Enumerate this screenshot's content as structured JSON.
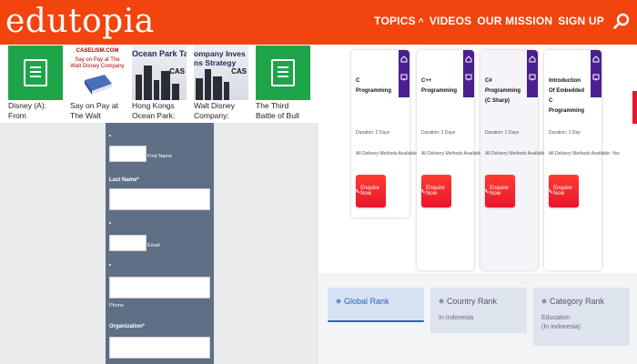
{
  "header": {
    "logo": "edutopia",
    "nav": [
      {
        "label": "TOPICS",
        "has_caret": true
      },
      {
        "label": "VIDEOS"
      },
      {
        "label": "OUR MISSION"
      },
      {
        "label": "SIGN UP"
      }
    ],
    "caret": "^",
    "search_icon": "search-icon",
    "color": "#f2440f"
  },
  "thumbnails": [
    {
      "kind": "notebook",
      "caption": "Disney (A): From"
    },
    {
      "kind": "book",
      "caption": "Say on Pay at The Walt",
      "top_text": "CASELISM.COM",
      "title_text": "Say on Pay at The Walt Disney Company"
    },
    {
      "kind": "city",
      "caption": "Hong Kongs Ocean Park:",
      "title_text": "Ocean Park Tal",
      "badge_text": "CAS"
    },
    {
      "kind": "city",
      "caption": "Walt Disney Company:",
      "title_text": "ompany Inves ns Strategy",
      "badge_text": "CAS"
    },
    {
      "kind": "notebook",
      "caption": "The Third Battle of Bull Run: The"
    }
  ],
  "form": {
    "first_name_label": "First Name",
    "last_name_label": "Last Name*",
    "email_label": "Email",
    "phone_label": "Phone",
    "organization_label": "Organization*",
    "bg_color": "#5f6f84"
  },
  "courses": [
    {
      "title": "C Programming",
      "duration": "Duration: 2 Days",
      "delivery": "All Delivery Methods Available: Yes",
      "button": "Enquire Now"
    },
    {
      "title": "C++ Programming",
      "duration": "Duration: 2 Days",
      "delivery": "All Delivery Methods Available: Yes",
      "button": "Enquire Now"
    },
    {
      "title": "C# Programming (C Sharp)",
      "duration": "Duration: 2 Days",
      "delivery": "All Delivery Methods Available: Yes",
      "button": "Enquire Now"
    },
    {
      "title": "Introduction Of Embedded C Programming",
      "duration": "Duration: 1 Day",
      "delivery": "All Delivery Methods Available: Yes",
      "button": "Enquire Now"
    }
  ],
  "ranks": {
    "global": {
      "label": "Global Rank"
    },
    "country": {
      "label": "Country Rank",
      "sub": "In Indonesia"
    },
    "category": {
      "label": "Category Rank",
      "sub1": "Education",
      "sub2": "(In Indonesia)"
    },
    "accent": "#2c64b8"
  }
}
